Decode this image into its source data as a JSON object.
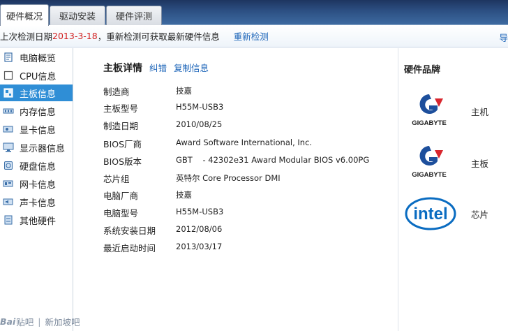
{
  "tabs": [
    {
      "label": "硬件概况",
      "active": true
    },
    {
      "label": "驱动安装",
      "active": false
    },
    {
      "label": "硬件评测",
      "active": false
    }
  ],
  "infobar": {
    "prefix": "上次检测日期 ",
    "date": "2013-3-18",
    "suffix": "，重新检测可获取最新硬件信息",
    "recheck": "重新检测",
    "edge": "导"
  },
  "sidebar": {
    "items": [
      {
        "label": "电脑概览",
        "icon": "computer-overview-icon"
      },
      {
        "label": "CPU信息",
        "icon": "cpu-icon"
      },
      {
        "label": "主板信息",
        "icon": "motherboard-icon",
        "active": true
      },
      {
        "label": "内存信息",
        "icon": "memory-icon"
      },
      {
        "label": "显卡信息",
        "icon": "graphics-card-icon"
      },
      {
        "label": "显示器信息",
        "icon": "monitor-icon"
      },
      {
        "label": "硬盘信息",
        "icon": "hard-disk-icon"
      },
      {
        "label": "网卡信息",
        "icon": "network-card-icon"
      },
      {
        "label": "声卡信息",
        "icon": "sound-card-icon"
      },
      {
        "label": "其他硬件",
        "icon": "other-hardware-icon"
      }
    ]
  },
  "main": {
    "title": "主板详情",
    "correct_link": "纠错",
    "copy_link": "复制信息",
    "rows": [
      {
        "key": "制造商",
        "value": "技嘉"
      },
      {
        "key": "主板型号",
        "value": "H55M-USB3"
      },
      {
        "key": "制造日期",
        "value": "2010/08/25"
      },
      {
        "key": "BIOS厂商",
        "value": "Award Software International, Inc."
      },
      {
        "key": "BIOS版本",
        "value": "GBT    - 42302e31 Award Modular BIOS v6.00PG"
      },
      {
        "key": "芯片组",
        "value": "英特尔 Core Processor DMI"
      },
      {
        "key": "电脑厂商",
        "value": "技嘉"
      },
      {
        "key": "电脑型号",
        "value": "H55M-USB3"
      },
      {
        "key": "系统安装日期",
        "value": "2012/08/06"
      },
      {
        "key": "最近启动时间",
        "value": "2013/03/17"
      }
    ]
  },
  "brands": {
    "title": "硬件品牌",
    "items": [
      {
        "logo_text": "GIGABYTE",
        "label": "主机"
      },
      {
        "logo_text": "GIGABYTE",
        "label": "主板"
      },
      {
        "logo_text": "intel",
        "label": "芯片"
      }
    ]
  },
  "footer": {
    "brand": "Bai",
    "brand2": "贴吧",
    "site": "新加坡吧"
  },
  "colors": {
    "accent": "#2f8ed6",
    "link": "#1a63b8",
    "date_red": "#d22020",
    "gigabyte_blue": "#1d4f9c",
    "gigabyte_red": "#d8262e",
    "intel_blue": "#0a6cc1"
  }
}
